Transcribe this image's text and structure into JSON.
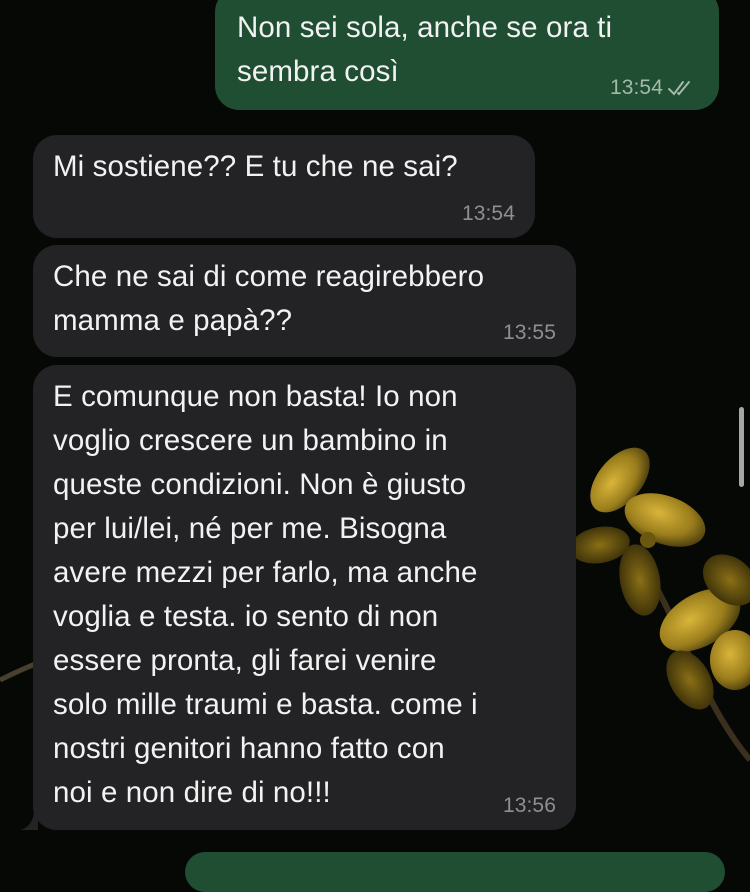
{
  "messages": [
    {
      "direction": "outgoing",
      "text": "Non sei sola, anche se ora ti\nsembra così",
      "time": "13:54",
      "status": "read"
    },
    {
      "direction": "incoming",
      "text": "Mi sostiene?? E tu che ne sai?",
      "time": "13:54"
    },
    {
      "direction": "incoming",
      "text": "Che ne sai di come reagirebbero\nmamma e papà??",
      "time": "13:55"
    },
    {
      "direction": "incoming",
      "text": "E comunque non basta! Io non\nvoglio crescere un bambino in\nqueste condizioni. Non è giusto\nper lui/lei, né per me. Bisogna\navere mezzi per farlo, ma anche\nvoglia e testa. io sento di non\nessere pronta, gli farei venire\nsolo mille traumi e basta. come i\nnostri genitori hanno fatto con\nnoi e non dire di no!!!",
      "time": "13:56"
    }
  ],
  "colors": {
    "background": "#060806",
    "incoming_bubble": "#232325",
    "outgoing_bubble": "#1f4e32",
    "timestamp": "#8e8f93",
    "wallpaper_flower": "#c9a62a"
  },
  "icons": {
    "read_ticks": "double-check-icon",
    "wallpaper": "yellow-flower-wallpaper"
  }
}
